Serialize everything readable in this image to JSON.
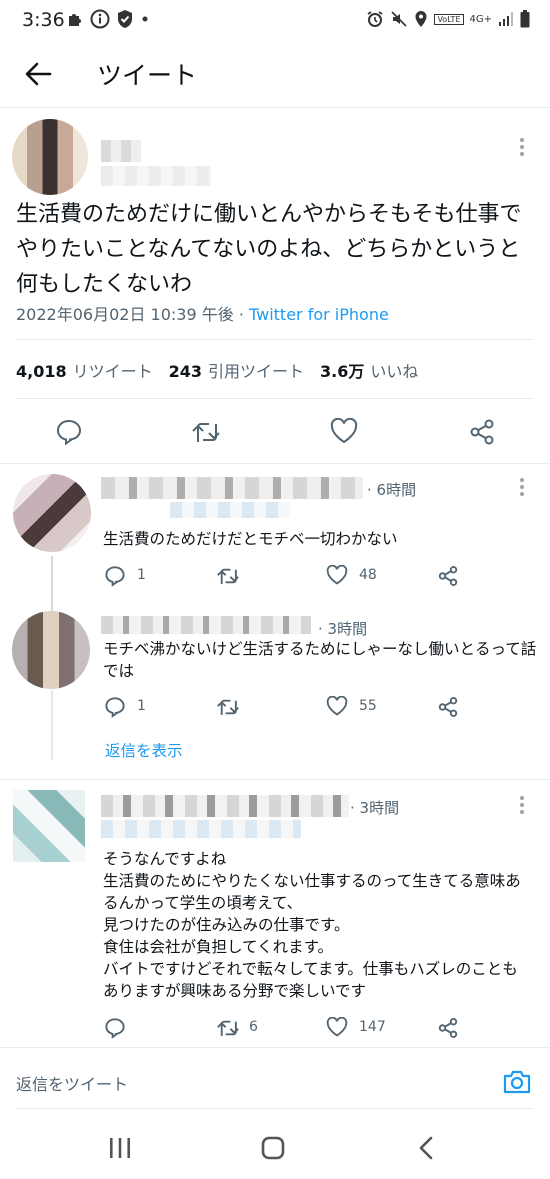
{
  "status_bar": {
    "time": "3:36",
    "network": "4G+",
    "volte": "VoLTE"
  },
  "header": {
    "title": "ツイート"
  },
  "tweet": {
    "text": "生活費のためだけに働いとんやからそもそも仕事でやりたいことなんてないのよね、どちらかというと何もしたくないわ",
    "date": "2022年06月02日 10:39 午後",
    "separator": " · ",
    "source": "Twitter for iPhone",
    "stats": {
      "retweets": "4,018",
      "retweets_label": "リツイート",
      "quotes": "243",
      "quotes_label": "引用ツイート",
      "likes": "3.6万",
      "likes_label": "いいね"
    }
  },
  "replies": [
    {
      "time": "· 6時間",
      "text": "生活費のためだけだとモチベ一切わかない",
      "reply_count": "1",
      "retweet_count": "",
      "like_count": "48"
    },
    {
      "time": "· 3時間",
      "text": "モチベ沸かないけど生活するためにしゃーなし働いとるって話では",
      "reply_count": "1",
      "retweet_count": "",
      "like_count": "55",
      "show_replies": "返信を表示"
    },
    {
      "time": "· 3時間",
      "lines": [
        "そうなんですよね",
        "生活費のためにやりたくない仕事するのって生きてる意味あるんかって学生の頃考えて、",
        "見つけたのが住み込みの仕事です。",
        "食住は会社が負担してくれます。",
        "バイトですけどそれで転々してます。仕事もハズレのこともありますが興味ある分野で楽しいです"
      ],
      "reply_count": "",
      "retweet_count": "6",
      "like_count": "147"
    }
  ],
  "reply_bar": {
    "placeholder": "返信をツイート"
  },
  "colors": {
    "accent": "#1d9bf0",
    "secondary_text": "#536471",
    "divider": "#e6ecf0"
  }
}
